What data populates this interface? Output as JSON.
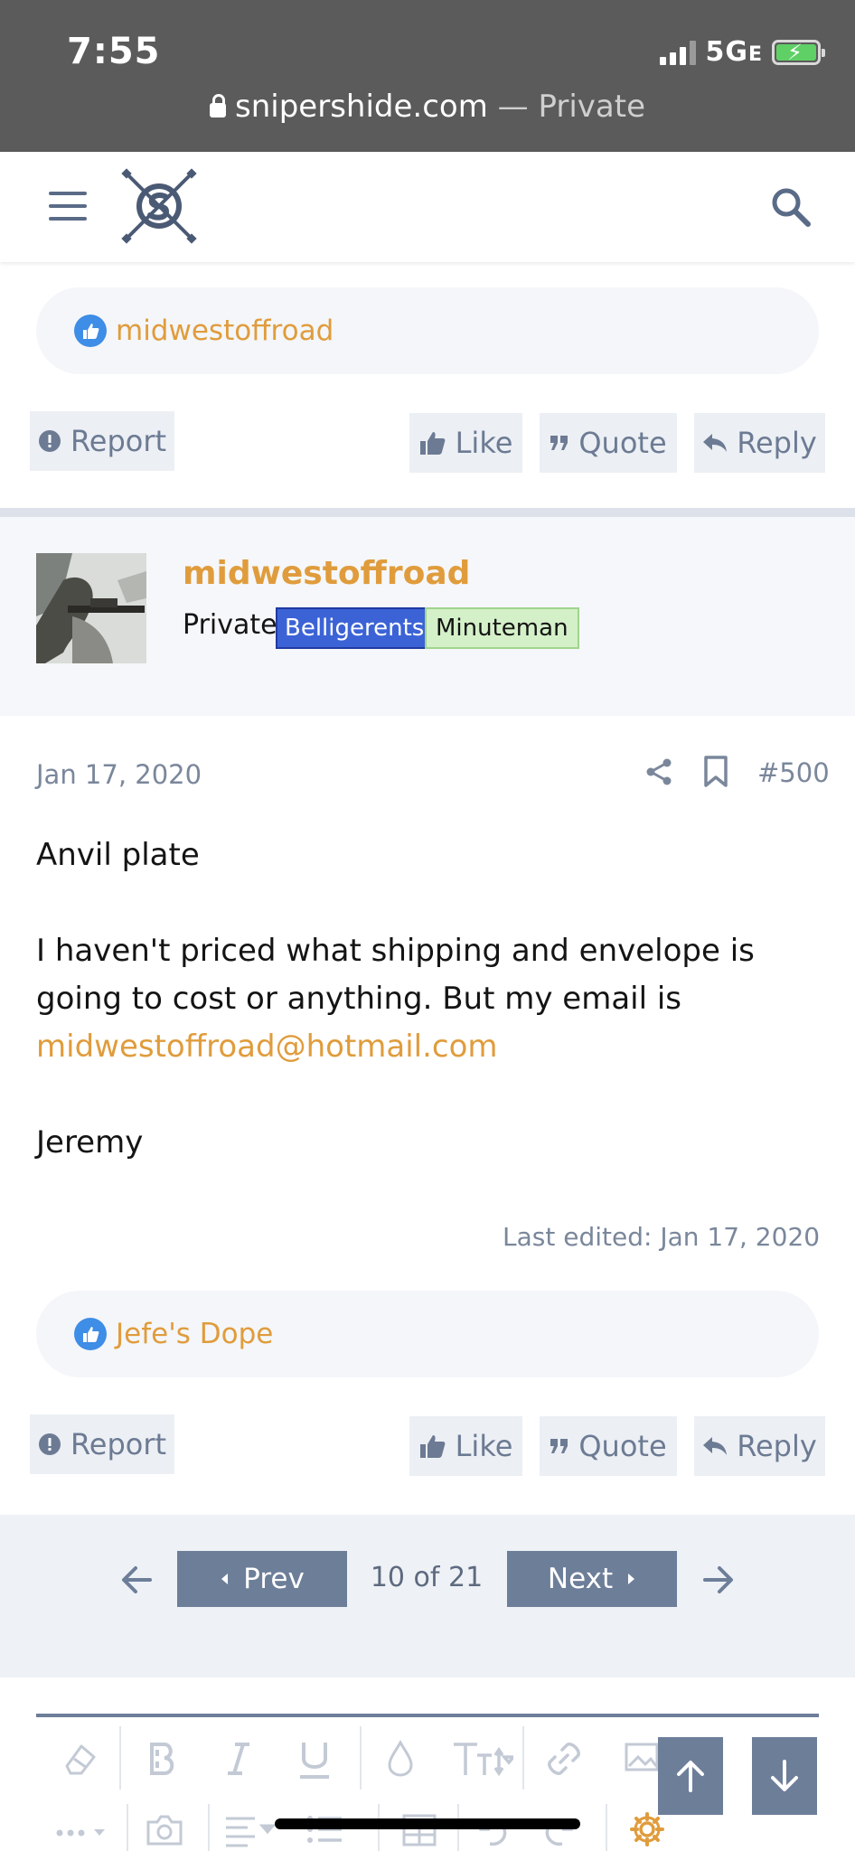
{
  "status": {
    "time": "7:55",
    "network": "5G",
    "network_suffix": "E",
    "url_domain": "snipershide.com",
    "url_private": "— Private"
  },
  "prev_post": {
    "reaction_user": "midwestoffroad",
    "actions": {
      "report": "Report",
      "like": "Like",
      "quote": "Quote",
      "reply": "Reply"
    }
  },
  "post": {
    "username": "midwestoffroad",
    "user_title": "Private",
    "badges": [
      "Belligerents",
      "Minuteman"
    ],
    "date": "Jan 17, 2020",
    "number": "#500",
    "body_line1": "Anvil plate",
    "body_line2": "I haven't priced what shipping and envelope is going to cost or anything. But my email is",
    "email": "midwestoffroad@hotmail.com",
    "signature": "Jeremy",
    "last_edited": "Last edited: Jan 17, 2020",
    "reaction_user": "Jefe's Dope",
    "actions": {
      "report": "Report",
      "like": "Like",
      "quote": "Quote",
      "reply": "Reply"
    }
  },
  "pagination": {
    "prev": "Prev",
    "next": "Next",
    "label": "10 of 21"
  },
  "colors": {
    "accent": "#e09c3c",
    "button_bg": "#6d7e99",
    "badge_blue": "#3c63d6",
    "badge_green": "#d4f0c8"
  },
  "icons": [
    "menu-icon",
    "site-logo",
    "search-icon",
    "like-reaction-icon",
    "report-icon",
    "like-icon",
    "quote-icon",
    "reply-icon",
    "share-icon",
    "bookmark-icon",
    "arrow-left-icon",
    "arrow-right-icon",
    "arrow-up-icon",
    "arrow-down-icon",
    "gear-icon"
  ]
}
